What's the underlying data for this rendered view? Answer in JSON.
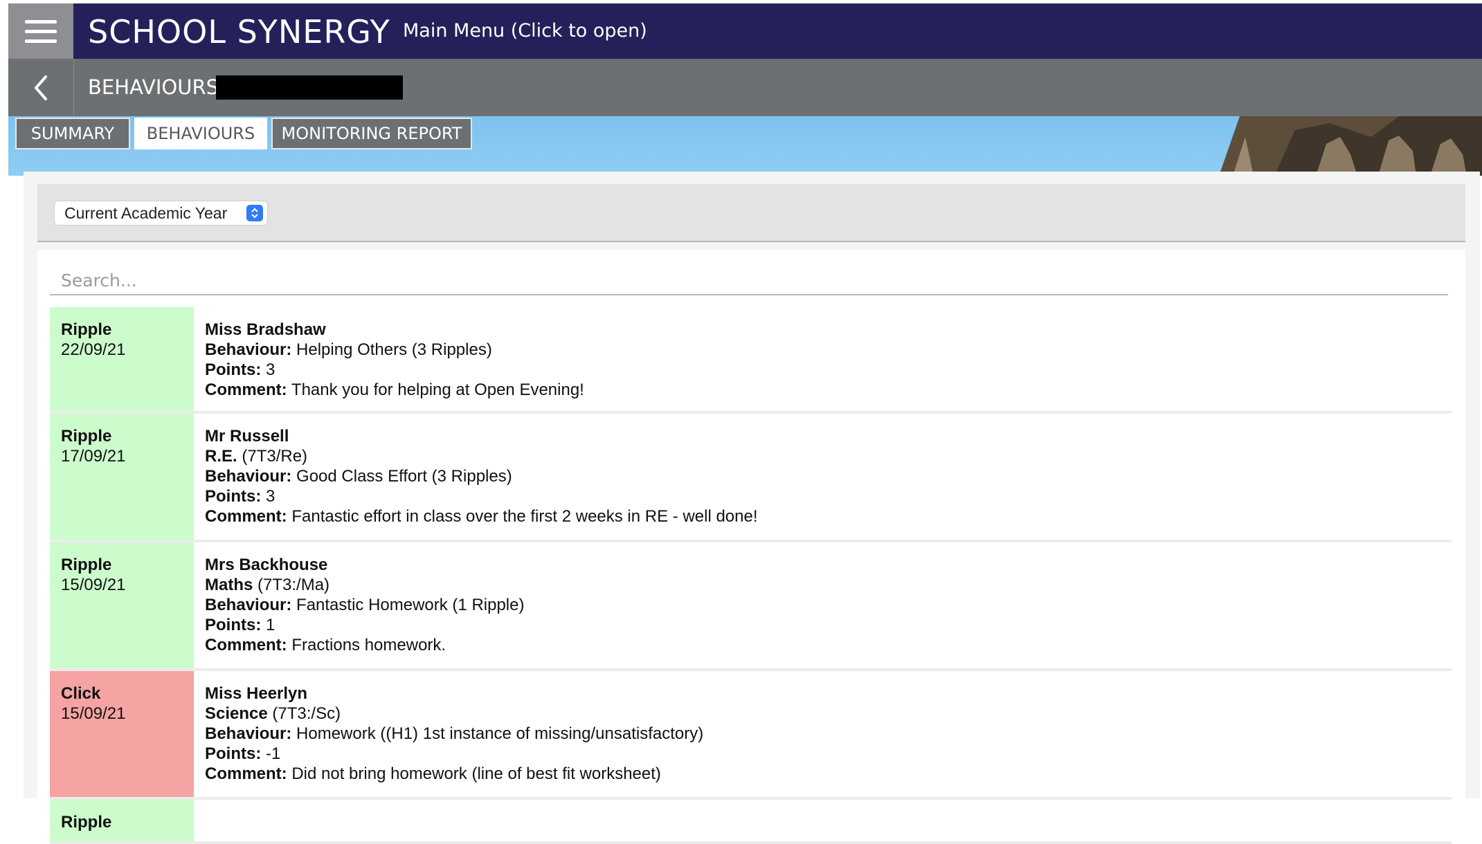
{
  "app": {
    "logo_text": "SCHOOL SYNERGY",
    "main_menu_label": "Main Menu (Click to open)",
    "menu_icon": "hamburger-icon"
  },
  "subheader": {
    "title": "BEHAVIOURS",
    "back_icon": "chevron-left-icon"
  },
  "tabs": [
    {
      "label": "SUMMARY",
      "active": false
    },
    {
      "label": "BEHAVIOURS",
      "active": true
    },
    {
      "label": "MONITORING REPORT",
      "active": false
    }
  ],
  "filter": {
    "selected": "Current Academic Year",
    "caret_icon": "up-down-chevron-icon"
  },
  "search": {
    "placeholder": "Search...",
    "value": ""
  },
  "labels": {
    "behaviour": "Behaviour:",
    "points": "Points:",
    "comment": "Comment:"
  },
  "colors": {
    "ripple": "#ccfbcc",
    "click": "#f5a3a3",
    "header": "#24205a",
    "subheader": "#6c7073"
  },
  "records": [
    {
      "type": "Ripple",
      "date": "22/09/21",
      "teacher": "Miss Bradshaw",
      "subject": "",
      "class": "",
      "behaviour": "Helping Others (3 Ripples)",
      "points": "3",
      "comment": "Thank you for helping at Open Evening!"
    },
    {
      "type": "Ripple",
      "date": "17/09/21",
      "teacher": "Mr Russell",
      "subject": "R.E.",
      "class": "(7T3/Re)",
      "behaviour": "Good Class Effort (3 Ripples)",
      "points": "3",
      "comment": "Fantastic effort in class over the first 2 weeks in RE - well done!"
    },
    {
      "type": "Ripple",
      "date": "15/09/21",
      "teacher": "Mrs Backhouse",
      "subject": "Maths",
      "class": "(7T3:/Ma)",
      "behaviour": "Fantastic Homework (1 Ripple)",
      "points": "1",
      "comment": "Fractions homework."
    },
    {
      "type": "Click",
      "date": "15/09/21",
      "teacher": "Miss Heerlyn",
      "subject": "Science",
      "class": "(7T3:/Sc)",
      "behaviour": "Homework ((H1) 1st instance of missing/unsatisfactory)",
      "points": "-1",
      "comment": "Did not bring homework (line of best fit worksheet)"
    },
    {
      "type": "Ripple",
      "date": "",
      "teacher": "",
      "subject": "",
      "class": "",
      "behaviour": "",
      "points": "",
      "comment": ""
    }
  ]
}
